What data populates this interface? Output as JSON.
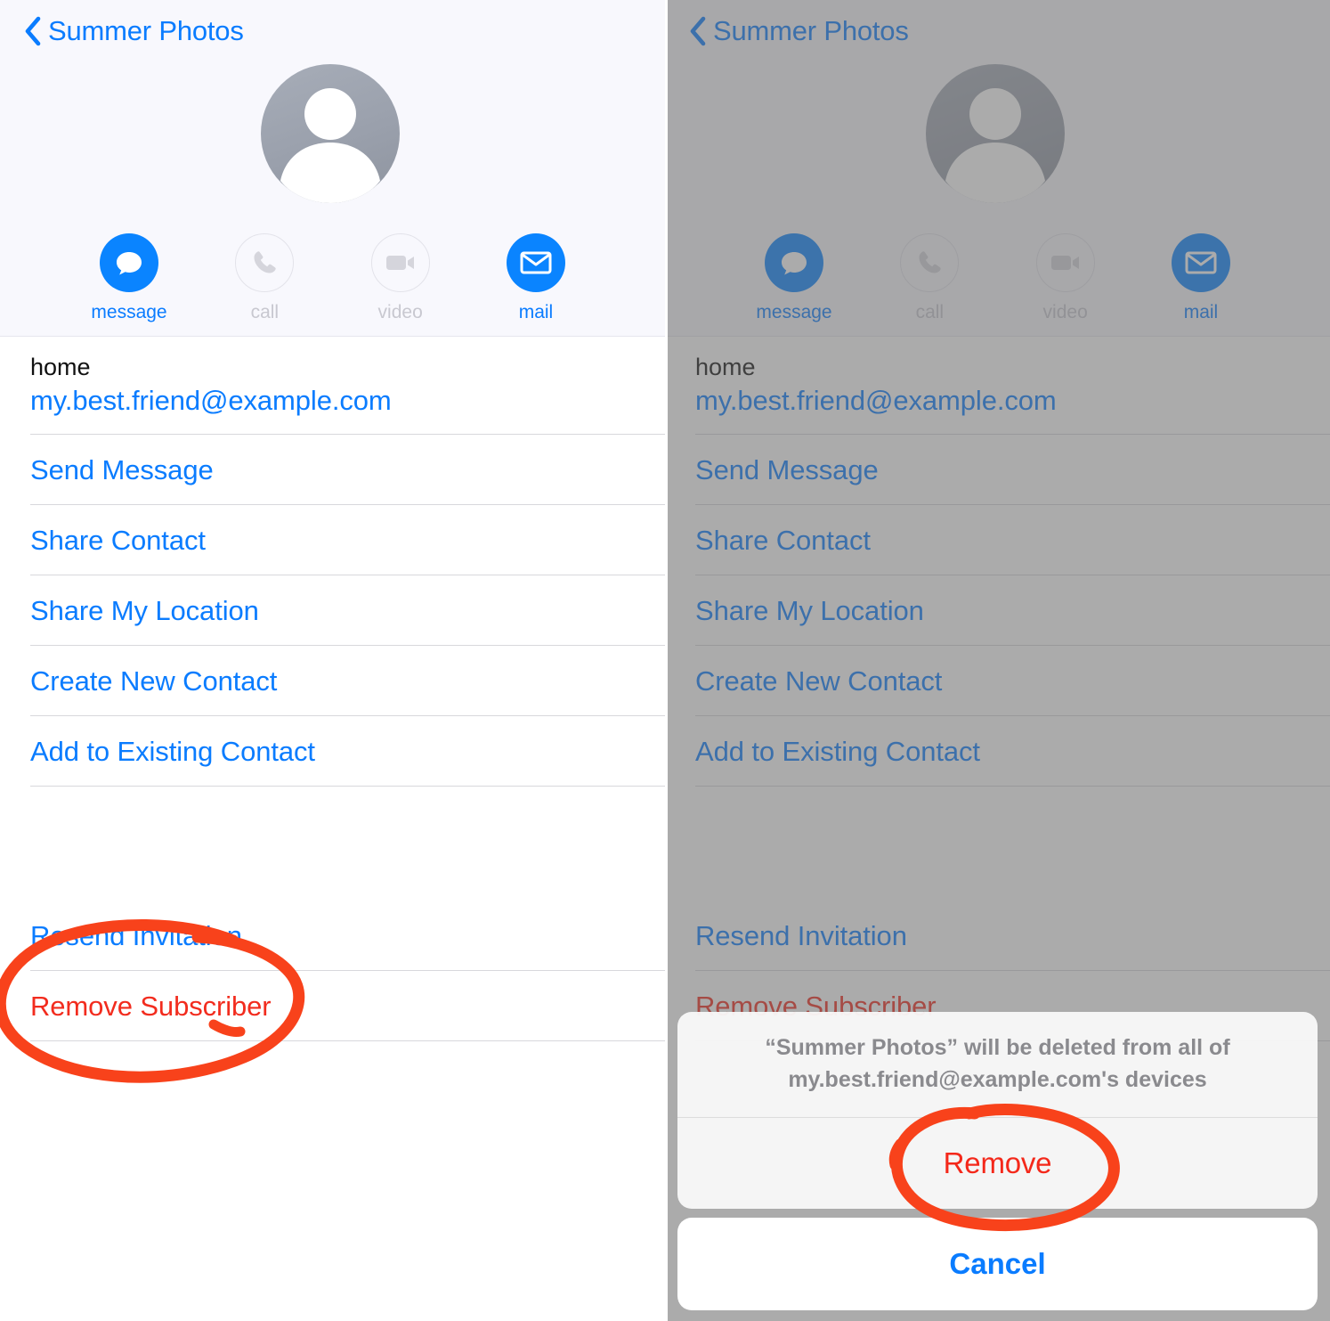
{
  "meta": {
    "accent_blue": "#0a7cff",
    "destructive_red": "#f22c1e",
    "annotation_red": "#f8421b",
    "header_bg": "#f8f8fd",
    "dim_overlay": "rgba(102,102,102,0.55)"
  },
  "nav": {
    "back_label": "Summer Photos",
    "back_icon": "chevron-left-icon"
  },
  "contact": {
    "avatar_icon": "person-placeholder-avatar",
    "actions": [
      {
        "label": "message",
        "icon": "message-bubble-icon",
        "enabled": true
      },
      {
        "label": "call",
        "icon": "phone-icon",
        "enabled": false
      },
      {
        "label": "video",
        "icon": "video-camera-icon",
        "enabled": false
      },
      {
        "label": "mail",
        "icon": "envelope-icon",
        "enabled": true
      }
    ]
  },
  "email_field": {
    "label": "home",
    "value": "my.best.friend@example.com"
  },
  "list_items": [
    {
      "label": "Send Message",
      "style": "link"
    },
    {
      "label": "Share Contact",
      "style": "link"
    },
    {
      "label": "Share My Location",
      "style": "link"
    },
    {
      "label": "Create New Contact",
      "style": "link"
    },
    {
      "label": "Add to Existing Contact",
      "style": "link"
    }
  ],
  "list_items_bottom": [
    {
      "label": "Resend Invitation",
      "style": "link"
    },
    {
      "label": "Remove Subscriber",
      "style": "destructive"
    }
  ],
  "action_sheet": {
    "message_line_1": "“Summer Photos” will be deleted from all of",
    "message_line_2": "my.best.friend@example.com's devices",
    "remove_label": "Remove",
    "cancel_label": "Cancel"
  },
  "annotations": {
    "left_circle_target": "Remove Subscriber",
    "right_circle_target": "Remove"
  }
}
